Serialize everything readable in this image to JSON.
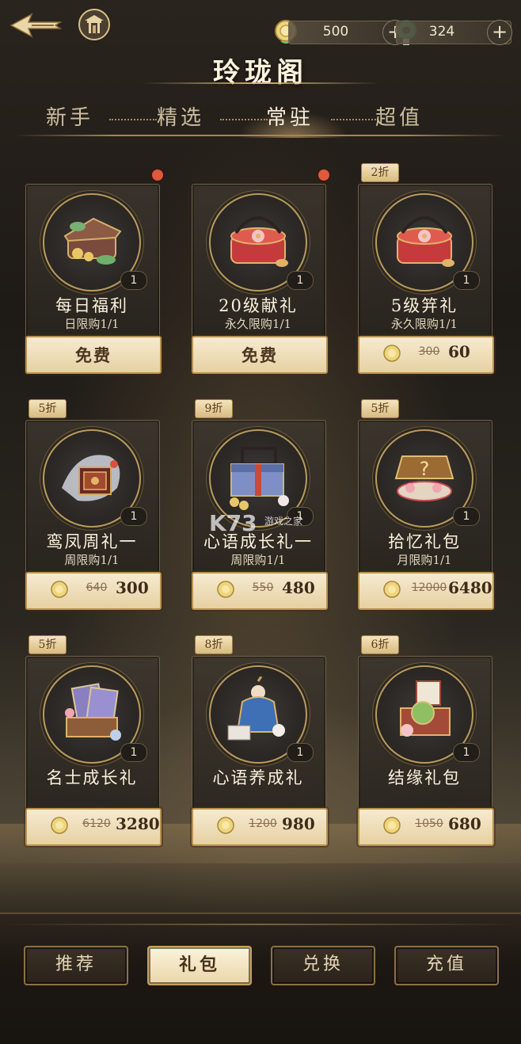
{
  "header": {
    "title": "玲珑阁",
    "back_icon": "back-arrow-icon",
    "home_icon": "pavilion-icon",
    "currencies": [
      {
        "name": "gold-coin",
        "value": "500",
        "plus": "+",
        "color": "#e8c766"
      },
      {
        "name": "jade",
        "value": "324",
        "plus": "+",
        "color": "#4fa07a"
      }
    ]
  },
  "tabs": [
    {
      "label": "新手",
      "active": false
    },
    {
      "label": "精选",
      "active": false
    },
    {
      "label": "常驻",
      "active": true
    },
    {
      "label": "超值",
      "active": false
    }
  ],
  "cards": [
    {
      "name": "每日福利",
      "limit": "日限购1/1",
      "qty": "1",
      "free": "免费",
      "badge": null,
      "dot": true
    },
    {
      "name": "20级献礼",
      "limit": "永久限购1/1",
      "qty": "1",
      "free": "免费",
      "badge": null,
      "dot": true
    },
    {
      "name": "5级笄礼",
      "limit": "永久限购1/1",
      "qty": "1",
      "orig": "300",
      "price": "60",
      "badge": "2折",
      "dot": false
    },
    {
      "name": "鸾凤周礼一",
      "limit": "周限购1/1",
      "qty": "1",
      "orig": "640",
      "price": "300",
      "badge": "5折",
      "dot": false
    },
    {
      "name": "心语成长礼一",
      "limit": "周限购1/1",
      "qty": "1",
      "orig": "550",
      "price": "480",
      "badge": "9折",
      "dot": false
    },
    {
      "name": "拾忆礼包",
      "limit": "月限购1/1",
      "qty": "1",
      "orig": "12000",
      "price": "6480",
      "badge": "5折",
      "dot": false
    },
    {
      "name": "名士成长礼",
      "limit": "",
      "qty": "1",
      "orig": "6120",
      "price": "3280",
      "badge": "5折",
      "dot": false
    },
    {
      "name": "心语养成礼",
      "limit": "",
      "qty": "1",
      "orig": "1200",
      "price": "980",
      "badge": "8折",
      "dot": false
    },
    {
      "name": "结缘礼包",
      "limit": "",
      "qty": "1",
      "orig": "1050",
      "price": "680",
      "badge": "6折",
      "dot": false
    }
  ],
  "watermark": "K73 游戏之家",
  "bottom_nav": [
    {
      "label": "推荐",
      "active": false
    },
    {
      "label": "礼包",
      "active": true
    },
    {
      "label": "兑换",
      "active": false
    },
    {
      "label": "充值",
      "active": false
    }
  ],
  "colors": {
    "accent_gold": "#d7b576",
    "sale_badge": "#e8d3a0",
    "red_dot": "#e0583d"
  }
}
